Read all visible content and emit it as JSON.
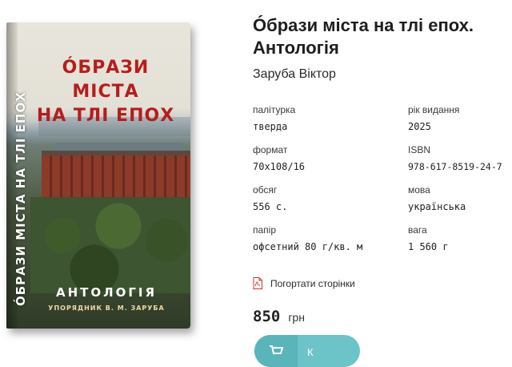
{
  "cover": {
    "title_line1": "ÓБРАЗИ МІСТА",
    "title_line2": "НА ТЛІ ЕПОХ",
    "spine": "ÓБРАЗИ МІСТА НА ТЛІ ЕПОХ",
    "anthology": "АНТОЛОГІЯ",
    "compiler": "УПОРЯДНИК В. М. ЗАРУБА"
  },
  "book": {
    "title": "Óбрази міста на тлі епох. Антологія",
    "author": "Заруба Віктор"
  },
  "specs": [
    {
      "label": "палітурка",
      "value": "тверда"
    },
    {
      "label": "рік видання",
      "value": "2025"
    },
    {
      "label": "формат",
      "value": "70x108/16"
    },
    {
      "label": "ISBN",
      "value": "978-617-8519-24-7"
    },
    {
      "label": "обсяг",
      "value": "556 с."
    },
    {
      "label": "мова",
      "value": "українська"
    },
    {
      "label": "папір",
      "value": "офсетний 80 г/кв. м"
    },
    {
      "label": "вага",
      "value": "1 560 г"
    }
  ],
  "preview_link": {
    "label": "Погортати сторінки",
    "icon": "pdf-icon"
  },
  "price": {
    "amount": "850",
    "currency": "грн"
  },
  "cart_button": {
    "label": "К",
    "icon": "cart-icon",
    "accent": "#6cc3c8"
  }
}
